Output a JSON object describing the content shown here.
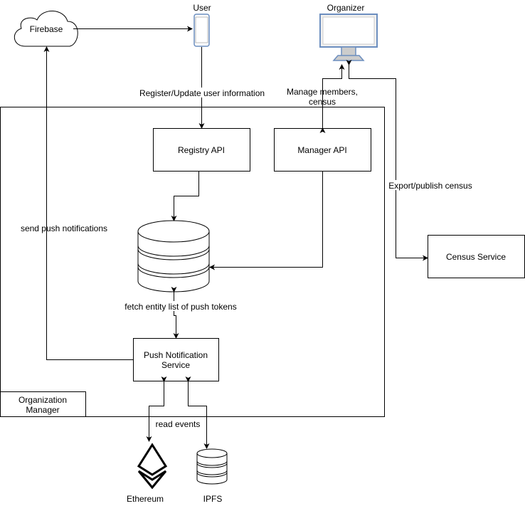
{
  "nodes": {
    "firebase": "Firebase",
    "user": "User",
    "organizer": "Organizer",
    "registry_api": "Registry API",
    "manager_api": "Manager API",
    "census_service": "Census Service",
    "push_service_line1": "Push Notification",
    "push_service_line2": "Service",
    "org_manager_line1": "Organization",
    "org_manager_line2": "Manager",
    "ethereum": "Ethereum",
    "ipfs": "IPFS"
  },
  "edges": {
    "register": "Register/Update user information",
    "manage_line1": "Manage members,",
    "manage_line2": "census",
    "export": "Export/publish census",
    "send_push": "send push notifications",
    "fetch": "fetch entity list of push tokens",
    "read_events": "read events"
  },
  "colors": {
    "monitor_frame": "#6c8ebf",
    "monitor_fill": "#f0f0f0",
    "monitor_stand": "#cccccc"
  }
}
